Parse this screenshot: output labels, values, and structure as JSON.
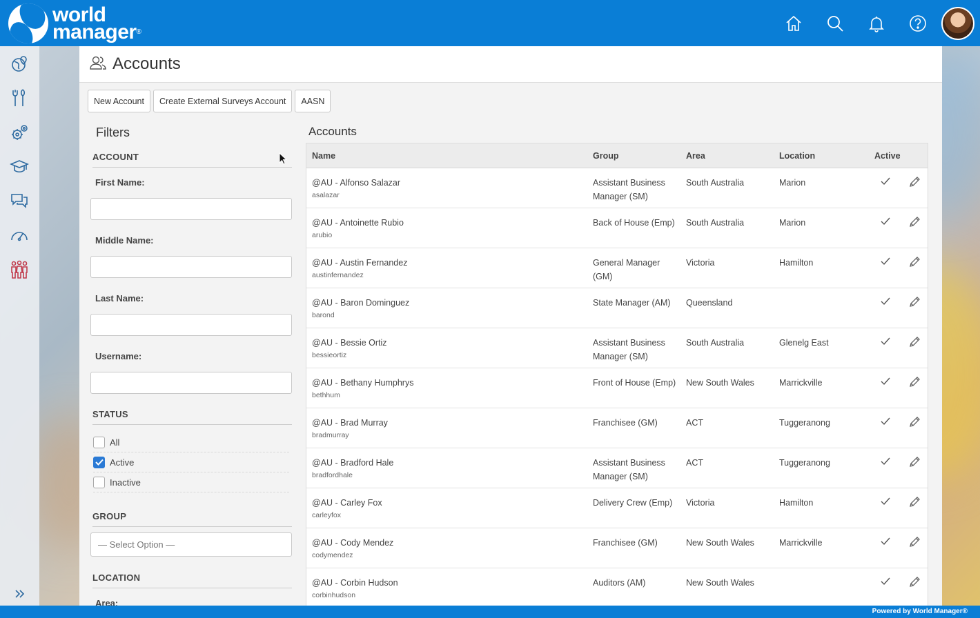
{
  "brand": {
    "line1": "world",
    "line2": "manager",
    "reg": "®"
  },
  "page": {
    "title": "Accounts"
  },
  "toolbar": {
    "new_account": "New Account",
    "create_external": "Create External Surveys Account",
    "aasn": "AASN"
  },
  "filters": {
    "title": "Filters",
    "account_section": "ACCOUNT",
    "first_name": "First Name:",
    "middle_name": "Middle Name:",
    "last_name": "Last Name:",
    "username": "Username:",
    "status_section": "STATUS",
    "status_options": [
      {
        "label": "All",
        "checked": false
      },
      {
        "label": "Active",
        "checked": true
      },
      {
        "label": "Inactive",
        "checked": false
      }
    ],
    "group_section": "GROUP",
    "group_placeholder": "— Select Option —",
    "location_section": "LOCATION",
    "area_label": "Area:"
  },
  "table": {
    "title": "Accounts",
    "columns": {
      "name": "Name",
      "group": "Group",
      "area": "Area",
      "location": "Location",
      "active": "Active"
    },
    "rows": [
      {
        "name": "@AU - Alfonso Salazar",
        "username": "asalazar",
        "group": "Assistant Business Manager (SM)",
        "area": "South Australia",
        "location": "Marion"
      },
      {
        "name": "@AU - Antoinette Rubio",
        "username": "arubio",
        "group": "Back of House (Emp)",
        "area": "South Australia",
        "location": "Marion"
      },
      {
        "name": "@AU - Austin Fernandez",
        "username": "austinfernandez",
        "group": "General Manager (GM)",
        "area": "Victoria",
        "location": "Hamilton"
      },
      {
        "name": "@AU - Baron Dominguez",
        "username": "barond",
        "group": "State Manager (AM)",
        "area": "Queensland",
        "location": ""
      },
      {
        "name": "@AU - Bessie Ortiz",
        "username": "bessieortiz",
        "group": "Assistant Business Manager (SM)",
        "area": "South Australia",
        "location": "Glenelg East"
      },
      {
        "name": "@AU - Bethany Humphrys",
        "username": "bethhum",
        "group": "Front of House (Emp)",
        "area": "New South Wales",
        "location": "Marrickville"
      },
      {
        "name": "@AU - Brad Murray",
        "username": "bradmurray",
        "group": "Franchisee (GM)",
        "area": "ACT",
        "location": "Tuggeranong"
      },
      {
        "name": "@AU - Bradford Hale",
        "username": "bradfordhale",
        "group": "Assistant Business Manager (SM)",
        "area": "ACT",
        "location": "Tuggeranong"
      },
      {
        "name": "@AU - Carley Fox",
        "username": "carleyfox",
        "group": "Delivery Crew (Emp)",
        "area": "Victoria",
        "location": "Hamilton"
      },
      {
        "name": "@AU - Cody Mendez",
        "username": "codymendez",
        "group": "Franchisee (GM)",
        "area": "New South Wales",
        "location": "Marrickville"
      },
      {
        "name": "@AU - Corbin Hudson",
        "username": "corbinhudson",
        "group": "Auditors (AM)",
        "area": "New South Wales",
        "location": ""
      }
    ]
  },
  "footer": {
    "text": "Powered by World Manager®"
  },
  "colors": {
    "brand_blue": "#0a7ed6",
    "checkbox_blue": "#2a7ad5"
  }
}
